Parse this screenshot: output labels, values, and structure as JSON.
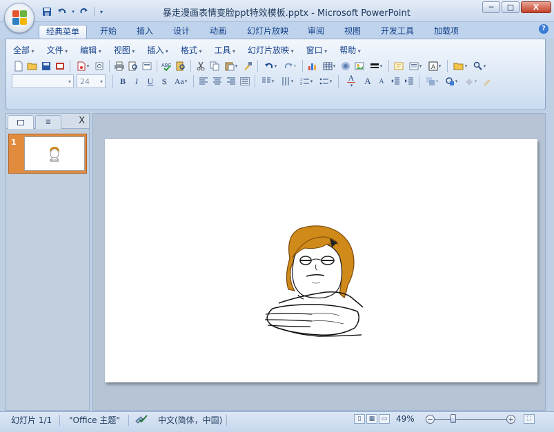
{
  "window": {
    "title": "暴走漫画表情变脸ppt特效模板.pptx - Microsoft PowerPoint",
    "controls": {
      "minimize": "─",
      "maximize": "□",
      "close": "X"
    }
  },
  "quick_access": [
    "save-icon",
    "undo-icon",
    "redo-icon",
    "customize-icon"
  ],
  "ribbon_tabs": [
    "经典菜单",
    "开始",
    "插入",
    "设计",
    "动画",
    "幻灯片放映",
    "审阅",
    "视图",
    "开发工具",
    "加载项"
  ],
  "active_tab": "经典菜单",
  "help_label": "?",
  "classic_menu": [
    "全部",
    "文件",
    "编辑",
    "视图",
    "插入",
    "格式",
    "工具",
    "幻灯片放映",
    "窗口",
    "帮助"
  ],
  "font": {
    "name_placeholder": "",
    "size_value": "24"
  },
  "format_buttons": {
    "bold": "B",
    "italic": "I",
    "underline": "U",
    "shadow": "S",
    "change_case": "Aa",
    "font_color": "A",
    "grow_font": "A",
    "shrink_font": "A"
  },
  "font_size_chip": "A",
  "left_pane": {
    "tabs": [
      "slides-tab",
      "outline-tab"
    ],
    "close": "X",
    "slides": [
      {
        "number": "1"
      }
    ]
  },
  "status": {
    "slide_info": "幻灯片 1/1",
    "theme": "\"Office 主题\"",
    "language": "中文(简体，中国)",
    "zoom": "49%",
    "zoom_level": 0.49
  },
  "colors": {
    "accent_orange": "#e18b3f",
    "hair": "#d08a1a",
    "ribbon_text": "#15428b"
  }
}
